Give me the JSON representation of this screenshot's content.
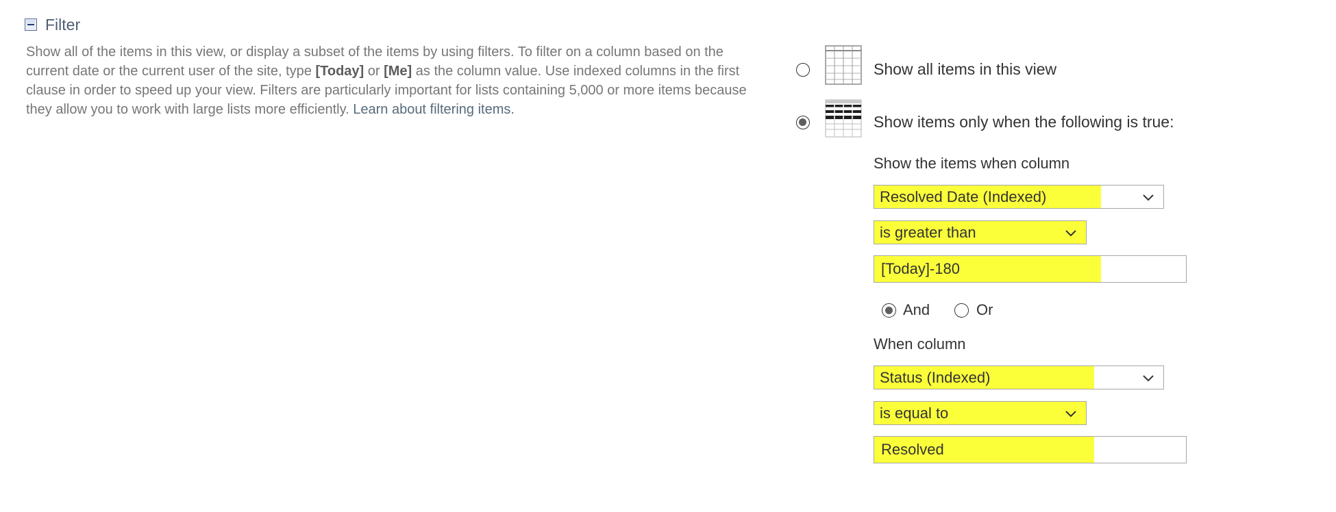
{
  "section": {
    "title": "Filter",
    "description_parts": {
      "p1": "Show all of the items in this view, or display a subset of the items by using filters. To filter on a column based on the current date or the current user of the site, type ",
      "today_token": "[Today]",
      "p2": " or ",
      "me_token": "[Me]",
      "p3": " as the column value. Use indexed columns in the first clause in order to speed up your view. Filters are particularly important for lists containing 5,000 or more items because they allow you to work with large lists more efficiently. ",
      "link": "Learn about filtering items."
    }
  },
  "options": {
    "show_all": {
      "label": "Show all items in this view",
      "checked": false,
      "icon": "table-grid-icon"
    },
    "show_filtered": {
      "label": "Show items only when the following is true:",
      "checked": true,
      "icon": "filtered-table-icon"
    }
  },
  "clause1": {
    "heading": "Show the items when column",
    "column_select": "Resolved Date (Indexed)",
    "operator_select": "is greater than",
    "value": "[Today]-180"
  },
  "logic": {
    "and_label": "And",
    "or_label": "Or",
    "selected": "And"
  },
  "clause2": {
    "heading": "When column",
    "column_select": "Status (Indexed)",
    "operator_select": "is equal to",
    "value": "Resolved"
  },
  "colors": {
    "highlight": "#fbff3a",
    "text": "#333333",
    "muted": "#767676",
    "border": "#a6a6a6"
  }
}
